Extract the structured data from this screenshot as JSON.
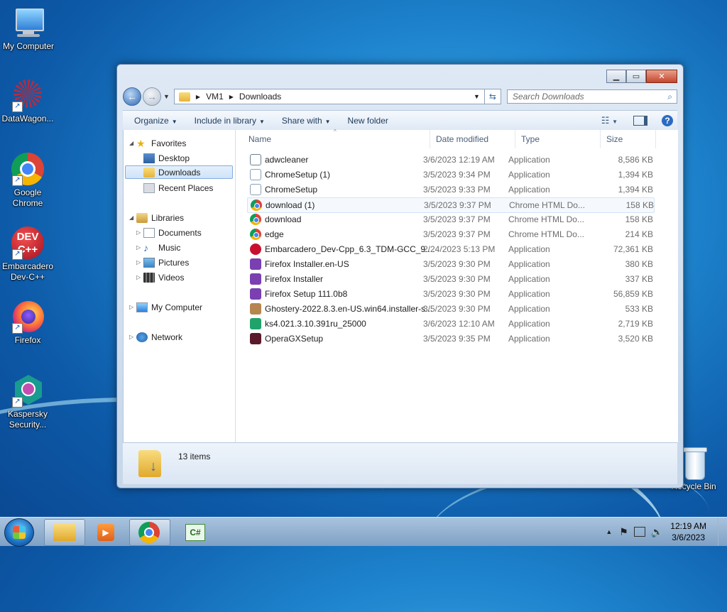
{
  "desktop": {
    "icons": [
      {
        "label": "My Computer",
        "icon": "computer-icon"
      },
      {
        "label": "DataWagon...",
        "icon": "datawagon-icon"
      },
      {
        "label": "Google Chrome",
        "icon": "chrome-icon"
      },
      {
        "label": "Embarcadero Dev-C++",
        "icon": "devcpp-icon"
      },
      {
        "label": "Firefox",
        "icon": "firefox-icon"
      },
      {
        "label": "Kaspersky Security...",
        "icon": "kaspersky-icon"
      },
      {
        "label": "Recycle Bin",
        "icon": "recycle-bin-icon"
      }
    ]
  },
  "window": {
    "breadcrumb": [
      "VM1",
      "Downloads"
    ],
    "search_placeholder": "Search Downloads",
    "toolbar": {
      "organize": "Organize",
      "include_in_library": "Include in library",
      "share_with": "Share with",
      "new_folder": "New folder"
    },
    "nav": {
      "favorites": "Favorites",
      "desktop": "Desktop",
      "downloads": "Downloads",
      "recent_places": "Recent Places",
      "libraries": "Libraries",
      "documents": "Documents",
      "music": "Music",
      "pictures": "Pictures",
      "videos": "Videos",
      "my_computer": "My Computer",
      "network": "Network"
    },
    "columns": {
      "name": "Name",
      "date": "Date modified",
      "type": "Type",
      "size": "Size"
    },
    "files": [
      {
        "name": "adwcleaner",
        "date": "3/6/2023 12:19 AM",
        "type": "Application",
        "size": "8,586 KB",
        "icon": "adwcleaner-icon",
        "color": "#6a7f96"
      },
      {
        "name": "ChromeSetup (1)",
        "date": "3/5/2023 9:34 PM",
        "type": "Application",
        "size": "1,394 KB",
        "icon": "setup-icon",
        "color": "#8aa0b8"
      },
      {
        "name": "ChromeSetup",
        "date": "3/5/2023 9:33 PM",
        "type": "Application",
        "size": "1,394 KB",
        "icon": "setup-icon",
        "color": "#8aa0b8"
      },
      {
        "name": "download (1)",
        "date": "3/5/2023 9:37 PM",
        "type": "Chrome HTML Do...",
        "size": "158 KB",
        "icon": "chrome-icon",
        "color": "#db4437"
      },
      {
        "name": "download",
        "date": "3/5/2023 9:37 PM",
        "type": "Chrome HTML Do...",
        "size": "158 KB",
        "icon": "chrome-icon",
        "color": "#db4437"
      },
      {
        "name": "edge",
        "date": "3/5/2023 9:37 PM",
        "type": "Chrome HTML Do...",
        "size": "214 KB",
        "icon": "chrome-icon",
        "color": "#db4437"
      },
      {
        "name": "Embarcadero_Dev-Cpp_6.3_TDM-GCC_9....",
        "date": "2/24/2023 5:13 PM",
        "type": "Application",
        "size": "72,361 KB",
        "icon": "devcpp-icon",
        "color": "#c8102e"
      },
      {
        "name": "Firefox Installer.en-US",
        "date": "3/5/2023 9:30 PM",
        "type": "Application",
        "size": "380 KB",
        "icon": "firefox-installer-icon",
        "color": "#7a3fb0"
      },
      {
        "name": "Firefox Installer",
        "date": "3/5/2023 9:30 PM",
        "type": "Application",
        "size": "337 KB",
        "icon": "firefox-installer-icon",
        "color": "#7a3fb0"
      },
      {
        "name": "Firefox Setup 111.0b8",
        "date": "3/5/2023 9:30 PM",
        "type": "Application",
        "size": "56,859 KB",
        "icon": "firefox-installer-icon",
        "color": "#7a3fb0"
      },
      {
        "name": "Ghostery-2022.8.3.en-US.win64.installer-s...",
        "date": "3/5/2023 9:30 PM",
        "type": "Application",
        "size": "533 KB",
        "icon": "installer-box-icon",
        "color": "#b5864f"
      },
      {
        "name": "ks4.021.3.10.391ru_25000",
        "date": "3/6/2023 12:10 AM",
        "type": "Application",
        "size": "2,719 KB",
        "icon": "kaspersky-cube-icon",
        "color": "#1fa36a"
      },
      {
        "name": "OperaGXSetup",
        "date": "3/5/2023 9:35 PM",
        "type": "Application",
        "size": "3,520 KB",
        "icon": "opera-gx-icon",
        "color": "#5a1a2a"
      }
    ],
    "status": {
      "item_count": "13 items"
    }
  },
  "taskbar": {
    "clock_time": "12:19 AM",
    "clock_date": "3/6/2023"
  }
}
